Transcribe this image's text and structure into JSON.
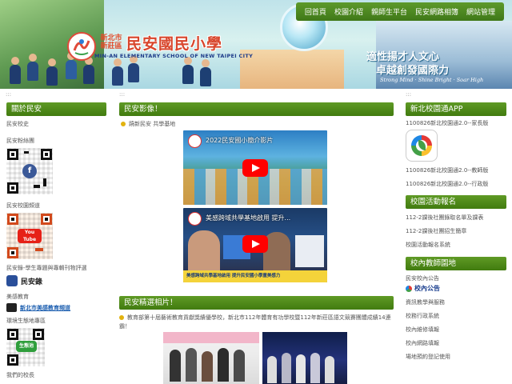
{
  "header": {
    "district": "新北市新莊區",
    "school_name": "民安國民小學",
    "school_en": "MIN-AN ELEMENTARY SCHOOL OF NEW TAIPEI CITY",
    "slogan_line1": "適性揚才人文心",
    "slogan_line2": "卓越創發國際力",
    "slogan_en": "Strong Mind · Shine Bright · Soar High"
  },
  "top_nav": [
    "回首頁",
    "校園介紹",
    "親師生平台",
    "民安網路相簿",
    "網站管理"
  ],
  "left": {
    "title": "關於民安",
    "school_song": "民安校史",
    "fanpage_label": "民安粉絲團",
    "channel_label": "民安校園頻道",
    "channel_badge": "You Tube",
    "record_label": "民安錄-學生專題與專輯刊物評選",
    "record_badge": "民安錄",
    "arts_label": "美感教育",
    "arts_link": "新北市美感教育頻道",
    "env_label": "環境生態地專區",
    "env_badge": "生態池",
    "principal_label": "我們的校長"
  },
  "main": {
    "video_section_title": "民安影像！",
    "video_news_item": "蹺新民安 共學基地",
    "video1_title": "2022民安國小簡介影片",
    "video2_title": "美感跨域共學基地啟用 提升...",
    "video2_caption": "美感跨域共學基地啟用 提升民安國小學童美感力",
    "photo_section_title": "民安精選相片！",
    "photo_news": "教育部第十屆藝術教育貢獻獎績優學校，新北市112年體育有功學校暨112年新莊區語文競賽團體成績14連霸！"
  },
  "right": {
    "app_title": "新北校園通APP",
    "app_items": [
      "1100826新北校園通2.0--家長版",
      "1100826新北校園通2.0--教師版",
      "1100826新北校園通2.0--行政版"
    ],
    "activity_title": "校園活動報名",
    "activity_items": [
      "112-2課後社團錄取名單及課表",
      "112-2課後社團招生簡章",
      "校園活動報名系統"
    ],
    "staff_title": "校內教師園地",
    "staff_items": [
      "民安校內公告",
      "校內公告",
      "資訊教學與服務",
      "校務行政系統",
      "校內維修填報",
      "校內網路填報",
      "場地預約登記使用"
    ]
  },
  "colors": {
    "section_green": "#4a8a17",
    "nav_green": "#4b8722",
    "title_red": "#d8452b"
  }
}
